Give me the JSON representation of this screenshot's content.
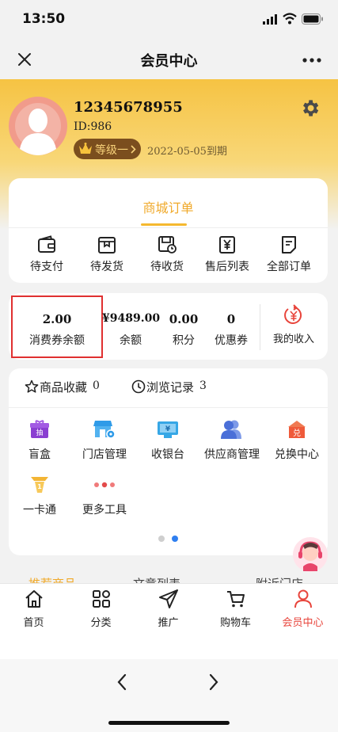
{
  "status_bar": {
    "time": "13:50"
  },
  "nav": {
    "title": "会员中心"
  },
  "profile": {
    "username": "12345678955",
    "id_text": "ID:986",
    "level_label": "等级一",
    "expire_text": "2022-05-05到期"
  },
  "orders": {
    "title": "商城订单",
    "items": [
      {
        "label": "待支付",
        "icon": "wallet-icon"
      },
      {
        "label": "待发货",
        "icon": "package-icon"
      },
      {
        "label": "待收货",
        "icon": "delivery-icon"
      },
      {
        "label": "售后列表",
        "icon": "yen-receipt-icon"
      },
      {
        "label": "全部订单",
        "icon": "order-list-icon"
      }
    ]
  },
  "stats": {
    "items": [
      {
        "value": "2.00",
        "label": "消费券余额"
      },
      {
        "value": "¥9489.00",
        "label": "余额"
      },
      {
        "value": "0.00",
        "label": "积分"
      },
      {
        "value": "0",
        "label": "优惠券"
      }
    ],
    "income_label": "我的收入"
  },
  "shortcuts": {
    "favorites_label": "商品收藏",
    "favorites_count": "0",
    "history_label": "浏览记录",
    "history_count": "3"
  },
  "tools": {
    "row1": [
      {
        "label": "盲盒",
        "icon": "blind-box-icon",
        "badge": "抽",
        "color": "#8a3fd1"
      },
      {
        "label": "门店管理",
        "icon": "store-icon",
        "color": "#2f9be8"
      },
      {
        "label": "收银台",
        "icon": "cashier-icon",
        "color": "#36a7e6"
      },
      {
        "label": "供应商管理",
        "icon": "supplier-icon",
        "color": "#4a6fd8"
      },
      {
        "label": "兑换中心",
        "icon": "exchange-icon",
        "badge": "兑",
        "color": "#ef5a3a"
      }
    ],
    "row2": [
      {
        "label": "一卡通",
        "icon": "card-icon",
        "color": "#f3b534"
      },
      {
        "label": "更多工具",
        "icon": "more-dots-icon",
        "color": "#e34b4b"
      }
    ]
  },
  "pager": {
    "count": 2,
    "active": 1
  },
  "peek_tabs": [
    "推荐商品",
    "文章列表",
    "附近门店"
  ],
  "tabbar": {
    "active_color": "#e8453c",
    "items": [
      {
        "label": "首页",
        "icon": "home-icon"
      },
      {
        "label": "分类",
        "icon": "category-icon"
      },
      {
        "label": "推广",
        "icon": "send-icon"
      },
      {
        "label": "购物车",
        "icon": "cart-icon"
      },
      {
        "label": "会员中心",
        "icon": "person-icon",
        "active": true
      }
    ]
  },
  "colors": {
    "accent": "#f5b92f",
    "highlight_border": "#e03030"
  }
}
